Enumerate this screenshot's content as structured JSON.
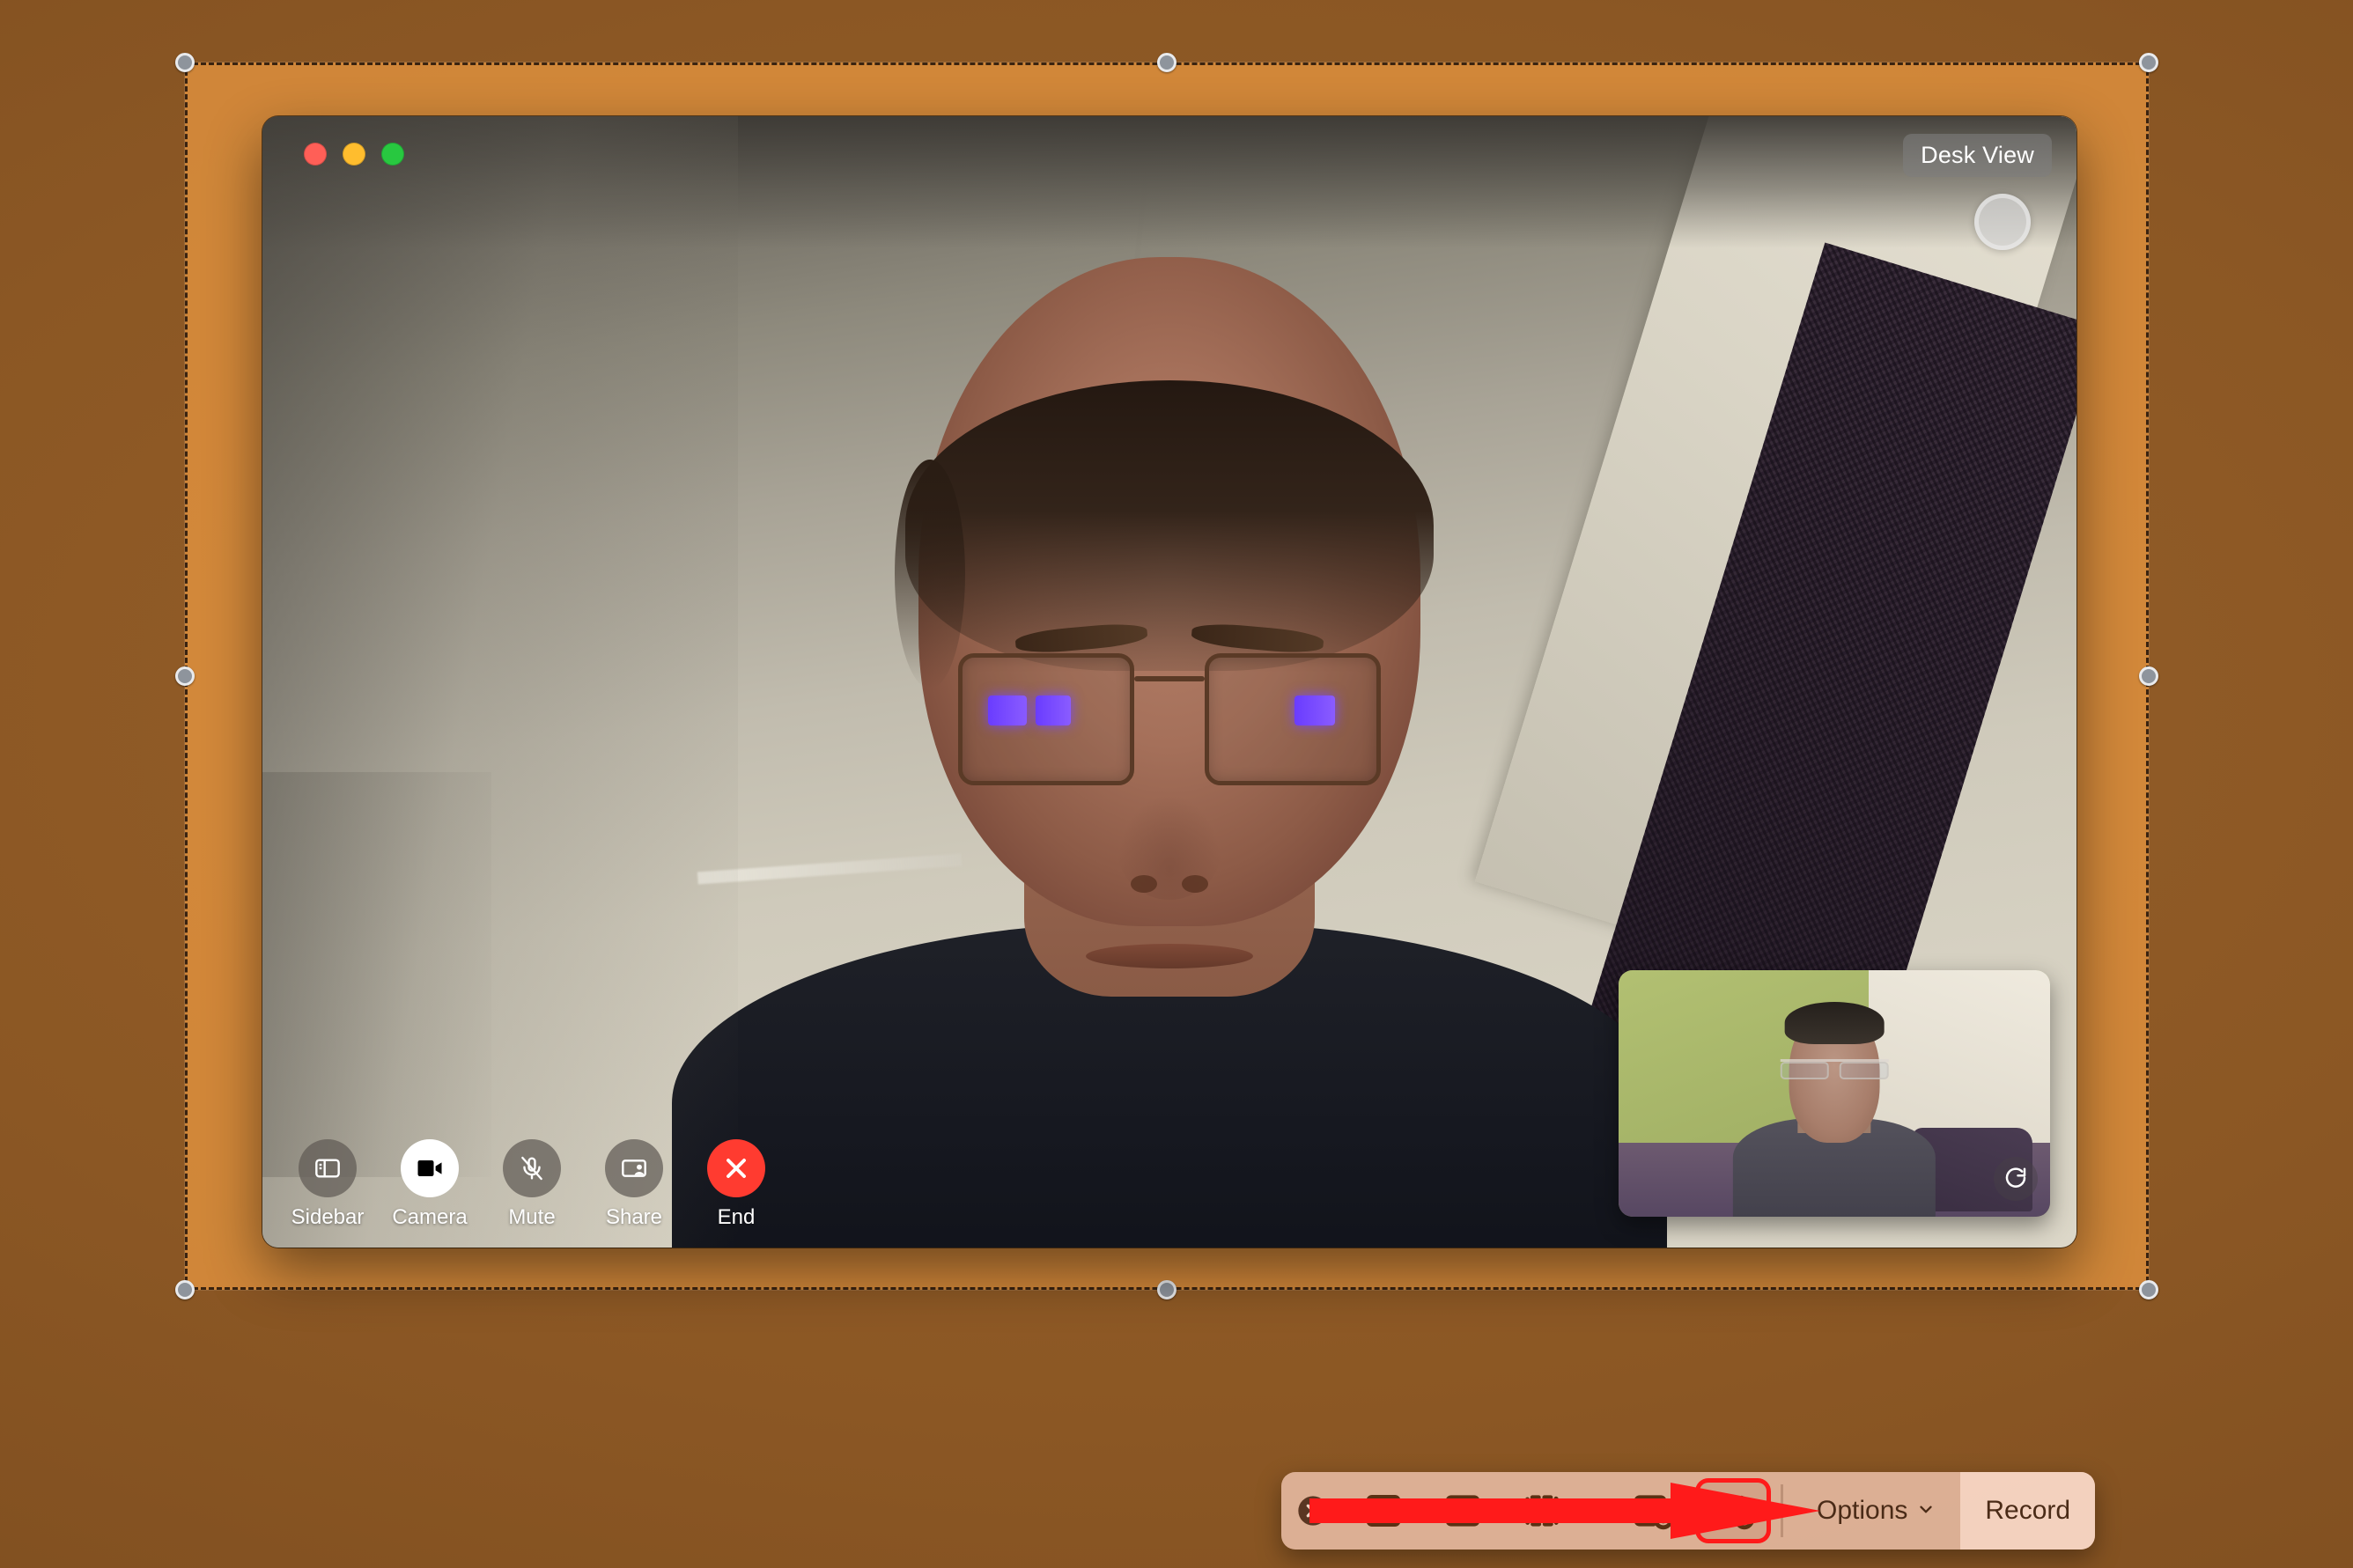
{
  "desktop": {
    "wallpaper_color": "#8b5724",
    "name": "macos-desktop"
  },
  "selection": {
    "name": "screen-recording-selection",
    "highlight_color": "#ffa648",
    "border_style": "dashed",
    "handles": [
      "top-left",
      "top-center",
      "top-right",
      "middle-left",
      "middle-right",
      "bottom-left",
      "bottom-center",
      "bottom-right"
    ]
  },
  "facetime_window": {
    "app": "FaceTime",
    "traffic_lights": [
      {
        "name": "close-button",
        "color": "#ff5f57"
      },
      {
        "name": "minimize-button",
        "color": "#ffbd2e"
      },
      {
        "name": "maximize-button",
        "color": "#28c840"
      }
    ],
    "desk_view_label": "Desk View",
    "camera_orb_name": "camera-lens-indicator",
    "pip": {
      "name": "self-view-pip",
      "rotate_icon": "rotate-clockwise-icon"
    },
    "controls": [
      {
        "icon": "sidebar-icon",
        "label": "Sidebar",
        "state": "inactive"
      },
      {
        "icon": "video-camera-icon",
        "label": "Camera",
        "state": "active"
      },
      {
        "icon": "microphone-muted-icon",
        "label": "Mute",
        "state": "inactive"
      },
      {
        "icon": "share-screen-icon",
        "label": "Share",
        "state": "inactive"
      },
      {
        "icon": "end-call-icon",
        "label": "End",
        "state": "danger"
      }
    ]
  },
  "capture_toolbar": {
    "name": "screenshot-capture-toolbar",
    "close_icon": "close-circle-icon",
    "tools": [
      {
        "icon": "capture-entire-screen-icon",
        "label": "Capture Entire Screen",
        "selected": false
      },
      {
        "icon": "capture-selected-window-icon",
        "label": "Capture Selected Window",
        "selected": false
      },
      {
        "icon": "capture-selected-portion-icon",
        "label": "Capture Selected Portion",
        "selected": false
      },
      {
        "icon": "record-entire-screen-icon",
        "label": "Record Entire Screen",
        "selected": false
      },
      {
        "icon": "record-selected-portion-icon",
        "label": "Record Selected Portion",
        "selected": true
      }
    ],
    "options_label": "Options",
    "options_chevron": "chevron-down-icon",
    "record_label": "Record",
    "background_color": "#e2b69d",
    "record_button_color": "#f4d3c0"
  },
  "annotation": {
    "name": "red-arrow-annotation",
    "color": "#ff1a1a",
    "points_to": "record-selected-portion-icon"
  }
}
